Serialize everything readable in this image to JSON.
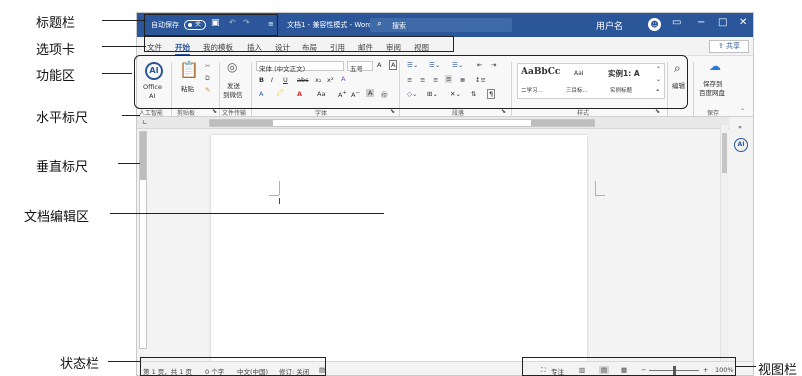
{
  "callouts": {
    "title_bar": "标题栏",
    "tabs": "选项卡",
    "ribbon": "功能区",
    "hruler": "水平标尺",
    "vruler": "垂直标尺",
    "doc_area": "文档编辑区",
    "status_bar": "状态栏",
    "view_bar": "视图栏"
  },
  "titlebar": {
    "autosave_label": "自动保存",
    "autosave_state": "关",
    "doc_title": "文档1 - 兼容性模式 - Word",
    "search_placeholder": "搜索",
    "user_name": "用户名",
    "avatar_initial": "☻",
    "icons": [
      "save-icon",
      "undo-icon",
      "redo-icon",
      "search-icon",
      "ribbon-display-icon",
      "minimize-icon",
      "maximize-icon",
      "close-icon"
    ]
  },
  "tabs": [
    "文件",
    "开始",
    "我的模板",
    "插入",
    "设计",
    "布局",
    "引用",
    "邮件",
    "审阅",
    "视图"
  ],
  "active_tab": "开始",
  "share_label": "共享",
  "ribbon": {
    "ai_label_1": "Office",
    "ai_label_2": "AI",
    "ai_group": "人工智能",
    "paste_label": "粘贴",
    "clipboard_group": "剪贴板",
    "send_label": "发送",
    "send_label2": "到微信",
    "transfer_group": "文件传输",
    "font_name": "宋体 (中文正文)",
    "font_size": "五号",
    "font_group": "字体",
    "bold": "B",
    "italic": "I",
    "underline": "U",
    "para_group": "段落",
    "style_1_title": "AaBbCc",
    "style_1_name": "二学习...",
    "style_2_title": "AaI",
    "style_2_name": "三目标...",
    "style_3_title": "实例1: A",
    "style_3_name": "实例标题",
    "styles_group": "样式",
    "edit_label": "编辑",
    "save_label_1": "保存到",
    "save_label_2": "百度网盘",
    "save_group": "保存"
  },
  "statusbar": {
    "page": "第 1 页，共 1 页",
    "words": "0 个字",
    "lang": "中文(中国)",
    "track": "修订: 关闭",
    "focus": "专注",
    "zoom": "100%"
  }
}
